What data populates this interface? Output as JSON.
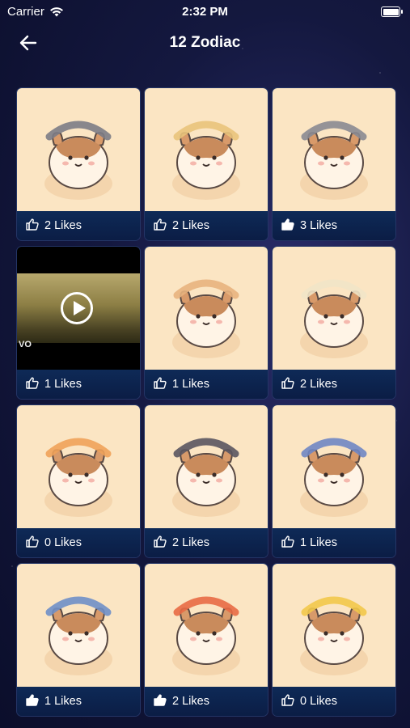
{
  "status": {
    "carrier": "Carrier",
    "time": "2:32 PM"
  },
  "nav": {
    "title": "12 Zodiac"
  },
  "colors": {
    "card_bg": "#fbe5c3",
    "bar_bg": "#0b1d45",
    "page_bg": "#14183f"
  },
  "cards": [
    {
      "likes": "2 Likes",
      "liked": false,
      "type": "sticker",
      "icon": "hamster-cow-icon"
    },
    {
      "likes": "2 Likes",
      "liked": false,
      "type": "sticker",
      "icon": "hamster-mermaid-icon"
    },
    {
      "likes": "3 Likes",
      "liked": true,
      "type": "sticker",
      "icon": "hamster-cats-icon"
    },
    {
      "likes": "1 Likes",
      "liked": false,
      "type": "video",
      "icon": "play-icon",
      "watermark": "VO"
    },
    {
      "likes": "1 Likes",
      "liked": false,
      "type": "sticker",
      "icon": "hamster-jar-icon"
    },
    {
      "likes": "2 Likes",
      "liked": false,
      "type": "sticker",
      "icon": "hamster-ram-icon"
    },
    {
      "likes": "0 Likes",
      "liked": false,
      "type": "sticker",
      "icon": "hamster-lion-icon"
    },
    {
      "likes": "2 Likes",
      "liked": false,
      "type": "sticker",
      "icon": "hamster-scorpion-icon"
    },
    {
      "likes": "1 Likes",
      "liked": false,
      "type": "sticker",
      "icon": "hamster-shark-icon"
    },
    {
      "likes": "1 Likes",
      "liked": true,
      "type": "sticker",
      "icon": "hamster-archer-icon"
    },
    {
      "likes": "2 Likes",
      "liked": true,
      "type": "sticker",
      "icon": "hamster-crab-icon"
    },
    {
      "likes": "0 Likes",
      "liked": false,
      "type": "sticker",
      "icon": "hamster-flowers-icon"
    }
  ]
}
